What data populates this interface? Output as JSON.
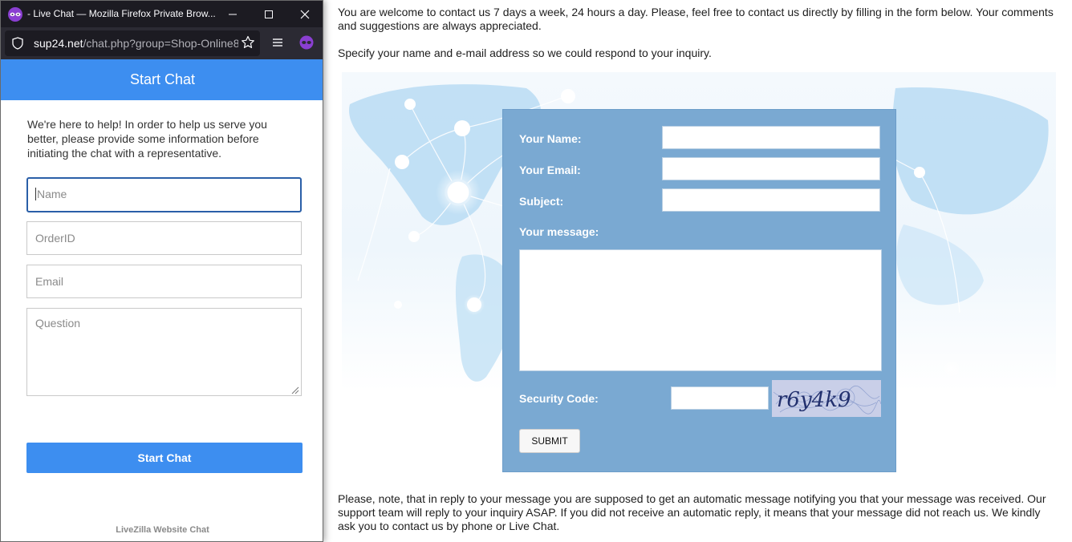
{
  "browser": {
    "window_title": "- Live Chat — Mozilla Firefox Private Brow...",
    "url_domain": "sup24.net",
    "url_path": "/chat.php?group=Shop-Online8"
  },
  "chat": {
    "header_title": "Start Chat",
    "intro_text": "We're here to help! In order to help us serve you better, please provide some information before initiating the chat with a representative.",
    "fields": {
      "name_placeholder": "Name",
      "orderid_placeholder": "OrderID",
      "email_placeholder": "Email",
      "question_placeholder": "Question"
    },
    "start_button": "Start Chat",
    "footer_brand": "LiveZilla Website Chat"
  },
  "page": {
    "intro_text": "You are welcome to contact us 7 days a week, 24 hours a day. Please, feel free to contact us directly by filling in the form below. Your comments and suggestions are always appreciated.",
    "specify_text": "Specify your name and e-mail address so we could respond to your inquiry.",
    "note_text": "Please, note, that in reply to your message you are supposed to get an automatic message notifying you that your message was received. Our support team will reply to your inquiry ASAP. If you did not receive an automatic reply, it means that your message did not reach us. We kindly ask you to contact us by phone or Live Chat."
  },
  "contact_form": {
    "name_label": "Your Name:",
    "email_label": "Your Email:",
    "subject_label": "Subject:",
    "message_label": "Your message:",
    "security_label": "Security Code:",
    "captcha_text": "r6y4k9",
    "submit_label": "SUBMIT"
  },
  "colors": {
    "chat_accent": "#3d8ef0",
    "form_panel": "#7aa9d2",
    "titlebar": "#1c1b22"
  }
}
